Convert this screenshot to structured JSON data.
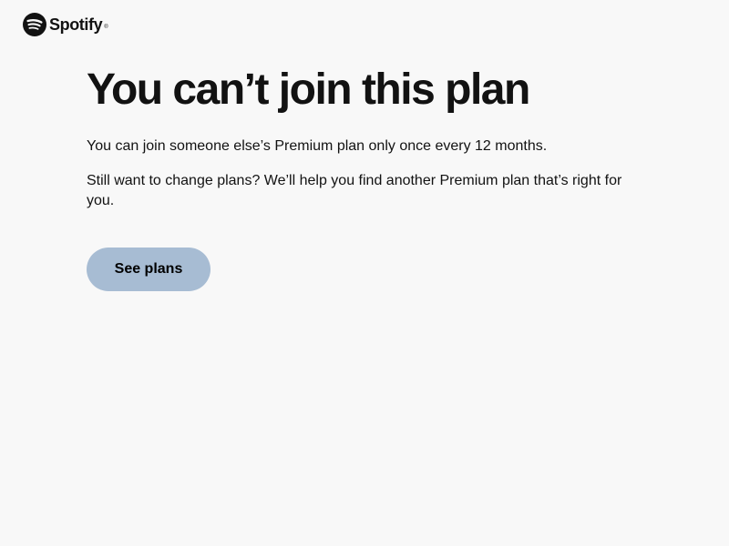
{
  "header": {
    "brand_name": "Spotify",
    "brand_tm": "®",
    "brand_icon": "spotify-logo-icon",
    "brand_color": "#121212"
  },
  "main": {
    "title": "You can’t join this plan",
    "paragraph_1": "You can join someone else’s Premium plan only once every 12 months.",
    "paragraph_2": "Still want to change plans? We’ll help you find another Premium plan that’s right for you.",
    "cta_label": "See plans",
    "cta_color": "#a7bcd3"
  },
  "page": {
    "background_color": "#f8f8f8"
  }
}
